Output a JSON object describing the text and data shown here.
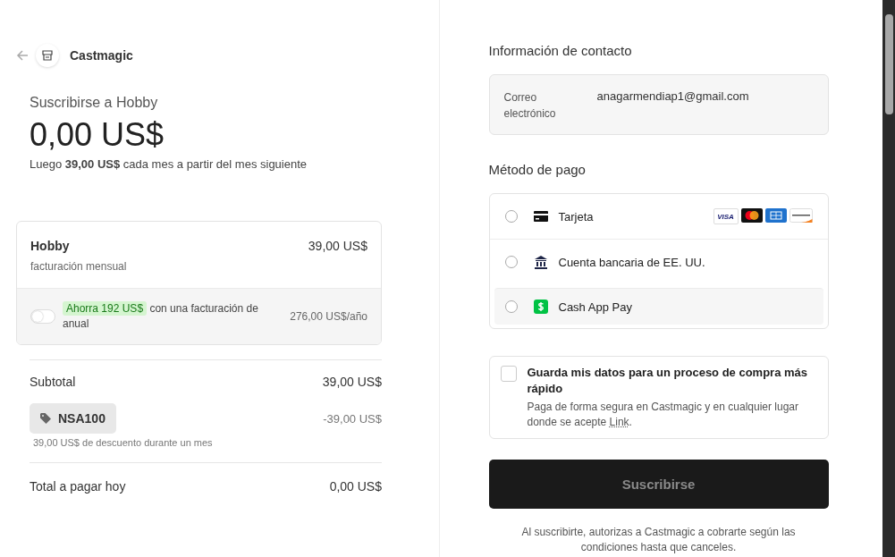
{
  "header": {
    "brand": "Castmagic"
  },
  "summary": {
    "title": "Suscribirse a Hobby",
    "price": "0,00 US$",
    "note": "Luego **39,00 US$** cada mes a partir del mes siguiente"
  },
  "plan": {
    "name": "Hobby",
    "billing": "facturación mensual",
    "price": "39,00 US$",
    "upsell": {
      "on": false,
      "badge": "Ahorra 192 US$",
      "text": "con una facturación de anual",
      "price": "276,00 US$/año"
    }
  },
  "subtotal": {
    "label": "Subtotal",
    "value": "39,00 US$"
  },
  "coupon": {
    "code": "NSA100",
    "amount": "-39,00 US$",
    "note": "39,00 US$ de descuento durante un mes"
  },
  "total": {
    "label": "Total a pagar hoy",
    "value": "0,00 US$"
  },
  "contact": {
    "title": "Información de contacto",
    "email_label": "Correo electrónico",
    "email": "anagarmendiap1@gmail.com"
  },
  "payment": {
    "title": "Método de pago",
    "methods": [
      {
        "kind": "card",
        "label": "Tarjeta",
        "selected": false,
        "highlighted": false,
        "brands": [
          {
            "kind": "visa",
            "text": "VISA"
          },
          {
            "kind": "mastercard"
          },
          {
            "kind": "amex"
          },
          {
            "kind": "discover"
          }
        ]
      },
      {
        "kind": "bank",
        "label": "Cuenta bancaria de EE. UU.",
        "selected": false,
        "highlighted": false
      },
      {
        "kind": "cashapp",
        "label": "Cash App Pay",
        "selected": false,
        "highlighted": true
      }
    ]
  },
  "save": {
    "checked": false,
    "title": "Guarda mis datos para un proceso de compra más rápido",
    "text": "Paga de forma segura en Castmagic y en cualquier lugar donde se acepte",
    "link": "Link",
    "end": "."
  },
  "submit": {
    "label": "Suscribirse"
  },
  "terms": "Al suscribirte, autorizas a Castmagic a cobrarte según las condiciones hasta que canceles."
}
